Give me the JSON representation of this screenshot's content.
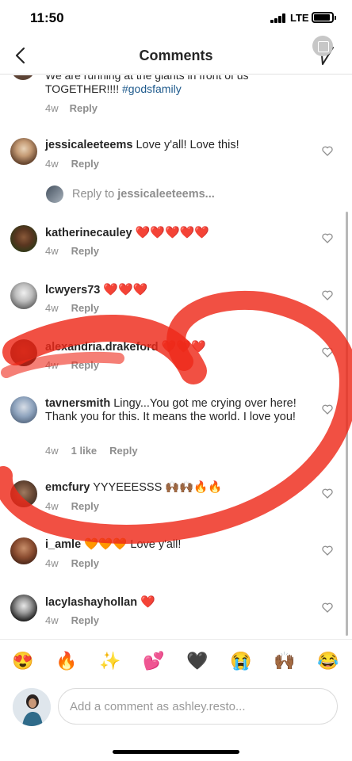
{
  "status": {
    "time": "11:50",
    "network": "LTE"
  },
  "header": {
    "title": "Comments"
  },
  "top_comment": {
    "line1": "We are running at the giants in front of us",
    "line2_prefix": "TOGETHER!!!! ",
    "hashtag": "#godsfamily",
    "age": "4w",
    "reply": "Reply"
  },
  "comments": [
    {
      "user": "jessicaleeteems",
      "text": "Love y'all! Love this!",
      "age": "4w",
      "reply": "Reply"
    },
    {
      "user": "katherinecauley",
      "text": "❤️❤️❤️❤️❤️",
      "age": "4w",
      "reply": "Reply"
    },
    {
      "user": "lcwyers73",
      "text": "❤️❤️❤️",
      "age": "4w",
      "reply": "Reply"
    },
    {
      "user": "alexandria.drakeford",
      "text": "❤️❤️❤️",
      "age": "4w",
      "reply": "Reply"
    },
    {
      "user": "tavnersmith",
      "text": "Lingy...You got me crying over here!  Thank you for this. It means the world. I love you!",
      "age": "4w",
      "likes": "1 like",
      "reply": "Reply"
    },
    {
      "user": "emcfury",
      "text": "YYYEEESSS 🙌🏾🙌🏾🔥🔥",
      "age": "4w",
      "reply": "Reply"
    },
    {
      "user": "i_amle",
      "text": "🧡🧡🧡 Love y'all!",
      "age": "4w",
      "reply": "Reply"
    },
    {
      "user": "lacylashayhollan",
      "text": "❤️",
      "age": "4w",
      "reply": "Reply"
    }
  ],
  "reply_prompt": {
    "prefix": "Reply to ",
    "user": "jessicaleeteems..."
  },
  "emoji_bar": [
    "😍",
    "🔥",
    "✨",
    "💕",
    "🖤",
    "😭",
    "🙌🏾",
    "😂"
  ],
  "composer": {
    "placeholder": "Add a comment as ashley.resto..."
  },
  "colors": {
    "heart": "#ed4956",
    "link": "#1e5a8c",
    "annotation": "#ee2a1a",
    "meta": "#8e8e8e"
  }
}
